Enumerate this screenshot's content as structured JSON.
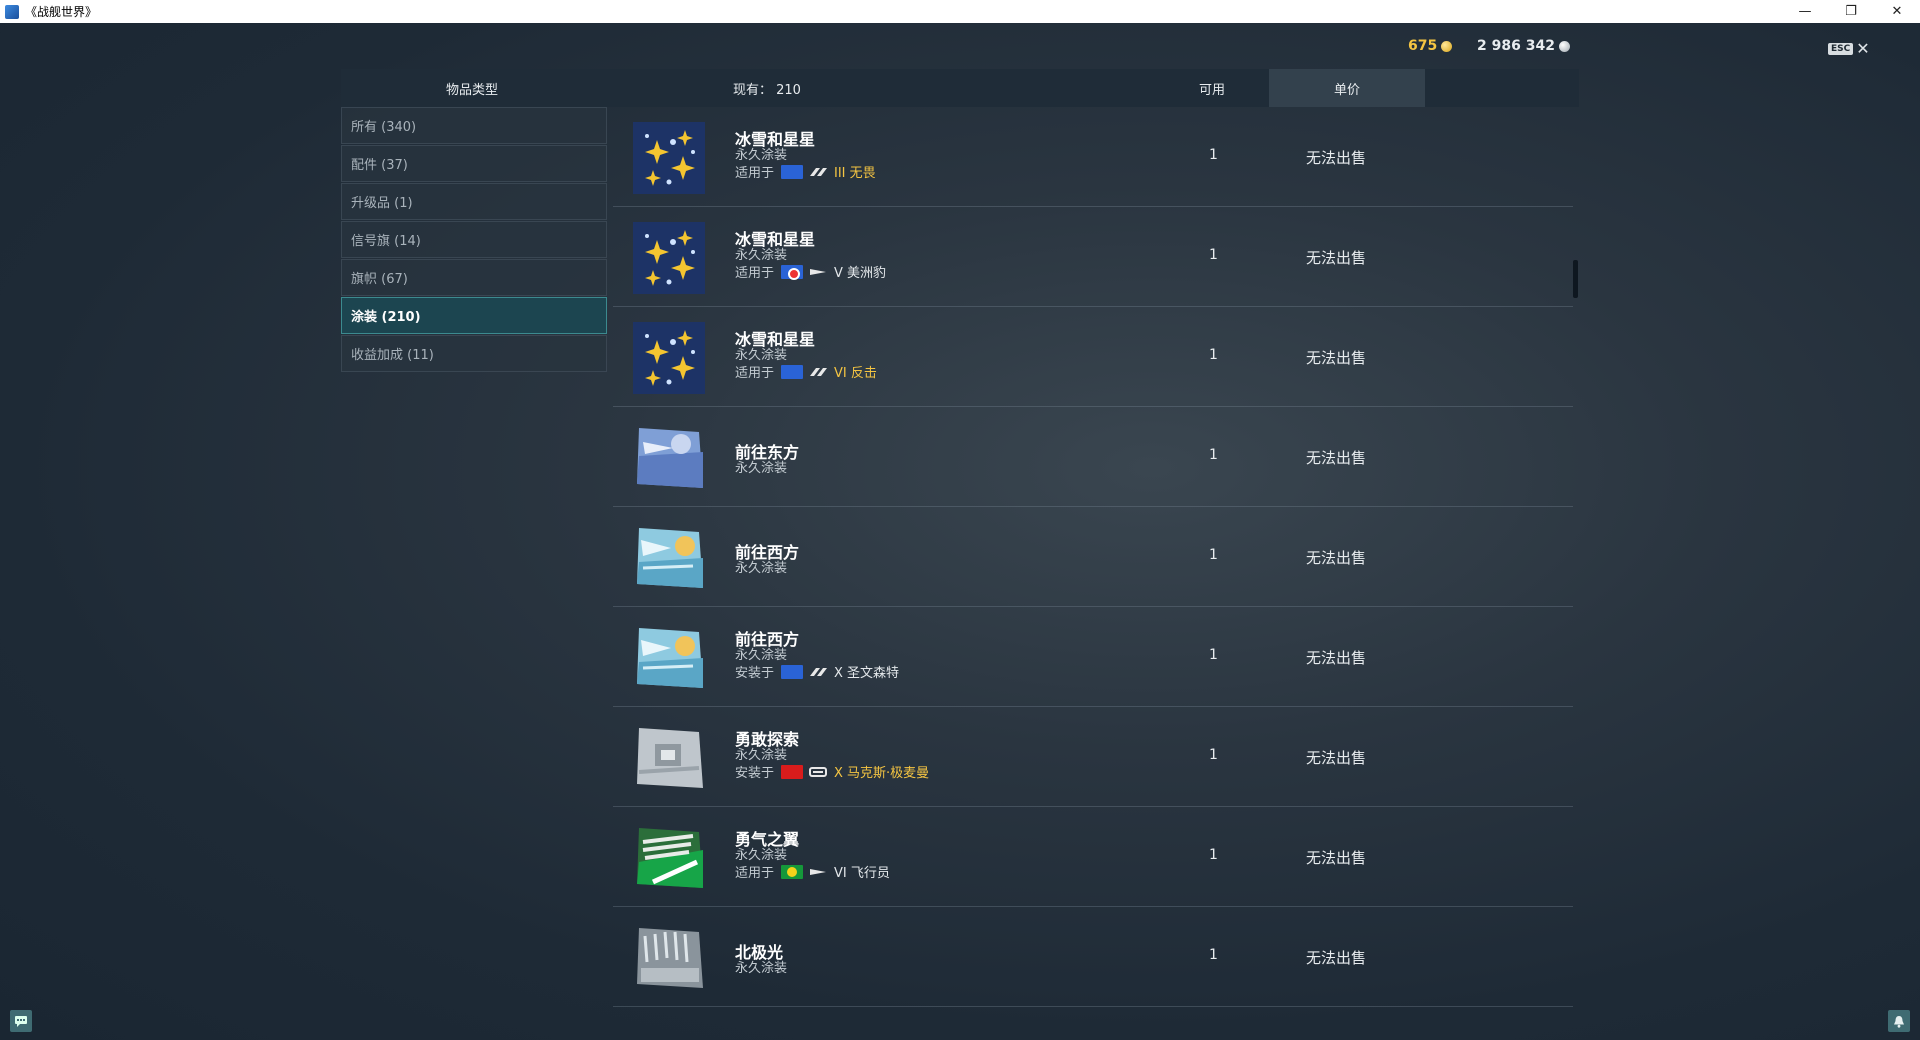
{
  "window": {
    "title": "《战舰世界》",
    "minimize": "—",
    "restore": "❐",
    "close": "✕"
  },
  "currency": {
    "gold": "675",
    "credits": "2 986 342"
  },
  "esc": {
    "key": "ESC",
    "close": "✕"
  },
  "header": {
    "type": "物品类型",
    "owned": "现有： 210",
    "available": "可用",
    "price": "单价"
  },
  "sidebar": {
    "items": [
      {
        "label": "所有 (340)"
      },
      {
        "label": "配件 (37)"
      },
      {
        "label": "升级品 (1)"
      },
      {
        "label": "信号旗 (14)"
      },
      {
        "label": "旗帜 (67)"
      },
      {
        "label": "涂装 (210)"
      },
      {
        "label": "收益加成 (11)"
      }
    ]
  },
  "items": [
    {
      "name": "冰雪和星星",
      "type": "永久涂装",
      "applies_label": "适用于",
      "flag": "france",
      "class_icon": "destroyer-icon",
      "ship": "III 无畏",
      "premium": true,
      "available": "1",
      "price": "无法出售",
      "thumb": "snowflake-stars"
    },
    {
      "name": "冰雪和星星",
      "type": "永久涂装",
      "applies_label": "适用于",
      "flag": "uk",
      "class_icon": "submarine-icon",
      "ship": "V 美洲豹",
      "premium": false,
      "available": "1",
      "price": "无法出售",
      "thumb": "snowflake-stars"
    },
    {
      "name": "冰雪和星星",
      "type": "永久涂装",
      "applies_label": "适用于",
      "flag": "france",
      "class_icon": "destroyer-icon",
      "ship": "VI 反击",
      "premium": true,
      "available": "1",
      "price": "无法出售",
      "thumb": "snowflake-stars"
    },
    {
      "name": "前往东方",
      "type": "永久涂装",
      "available": "1",
      "price": "无法出售",
      "thumb": "east"
    },
    {
      "name": "前往西方",
      "type": "永久涂装",
      "available": "1",
      "price": "无法出售",
      "thumb": "west"
    },
    {
      "name": "前往西方",
      "type": "永久涂装",
      "applies_label": "安装于",
      "flag": "france",
      "class_icon": "destroyer-icon",
      "ship": "X 圣文森特",
      "premium": false,
      "available": "1",
      "price": "无法出售",
      "thumb": "west"
    },
    {
      "name": "勇敢探索",
      "type": "永久涂装",
      "applies_label": "安装于",
      "flag": "germany",
      "class_icon": "battleship-icon",
      "ship": "X 马克斯·极麦曼",
      "premium": true,
      "available": "1",
      "price": "无法出售",
      "thumb": "explore"
    },
    {
      "name": "勇气之翼",
      "type": "永久涂装",
      "applies_label": "适用于",
      "flag": "brazil",
      "class_icon": "submarine-icon",
      "ship": "VI 飞行员",
      "premium": false,
      "available": "1",
      "price": "无法出售",
      "thumb": "wings"
    },
    {
      "name": "北极光",
      "type": "永久涂装",
      "available": "1",
      "price": "无法出售",
      "thumb": "aurora"
    }
  ]
}
